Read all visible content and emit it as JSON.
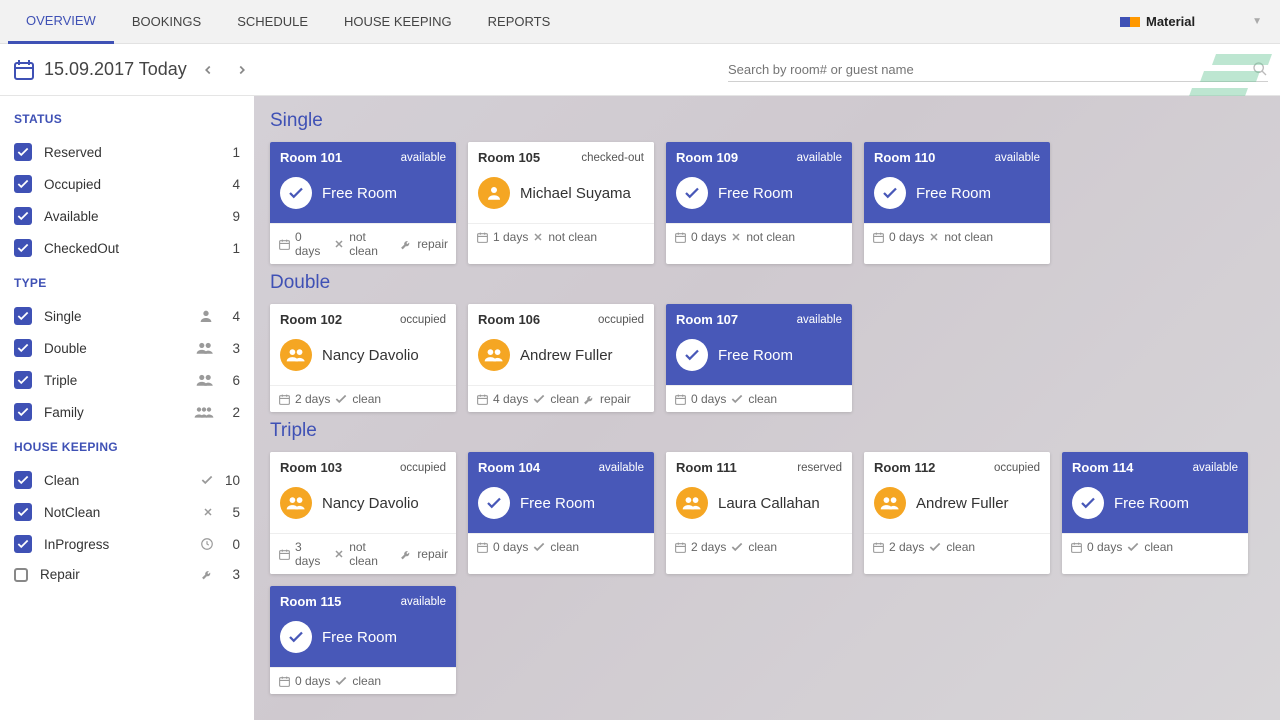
{
  "nav": {
    "tabs": [
      "OVERVIEW",
      "BOOKINGS",
      "SCHEDULE",
      "HOUSE KEEPING",
      "REPORTS"
    ],
    "active": 0
  },
  "theme": {
    "name": "Material",
    "swatch": [
      "#3f51b5",
      "#ff9800"
    ]
  },
  "date": {
    "text": "15.09.2017 Today"
  },
  "search": {
    "placeholder": "Search by room# or guest name"
  },
  "sidebar": {
    "groups": [
      {
        "title": "STATUS",
        "items": [
          {
            "label": "Reserved",
            "checked": true,
            "count": 1
          },
          {
            "label": "Occupied",
            "checked": true,
            "count": 4
          },
          {
            "label": "Available",
            "checked": true,
            "count": 9
          },
          {
            "label": "CheckedOut",
            "checked": true,
            "count": 1
          }
        ]
      },
      {
        "title": "TYPE",
        "items": [
          {
            "label": "Single",
            "checked": true,
            "icon": "person",
            "count": 4
          },
          {
            "label": "Double",
            "checked": true,
            "icon": "group",
            "count": 3
          },
          {
            "label": "Triple",
            "checked": true,
            "icon": "group",
            "count": 6
          },
          {
            "label": "Family",
            "checked": true,
            "icon": "group3",
            "count": 2
          }
        ]
      },
      {
        "title": "HOUSE KEEPING",
        "items": [
          {
            "label": "Clean",
            "checked": true,
            "icon": "check",
            "count": 10
          },
          {
            "label": "NotClean",
            "checked": true,
            "icon": "x",
            "count": 5
          },
          {
            "label": "InProgress",
            "checked": true,
            "icon": "clock",
            "count": 0
          },
          {
            "label": "Repair",
            "checked": false,
            "icon": "wrench",
            "count": 3
          }
        ]
      }
    ]
  },
  "sections": [
    {
      "title": "Single",
      "rooms": [
        {
          "name": "Room 101",
          "status": "available",
          "theme": "avail",
          "guest": "Free Room",
          "footer": [
            {
              "i": "cal",
              "t": "0 days"
            },
            {
              "i": "x",
              "t": "not clean"
            },
            {
              "i": "wrench",
              "t": "repair"
            }
          ]
        },
        {
          "name": "Room 105",
          "status": "checked-out",
          "theme": "white",
          "guest": "Michael Suyama",
          "guestIcon": "person",
          "footer": [
            {
              "i": "cal",
              "t": "1 days"
            },
            {
              "i": "x",
              "t": "not clean"
            }
          ]
        },
        {
          "name": "Room 109",
          "status": "available",
          "theme": "avail",
          "guest": "Free Room",
          "footer": [
            {
              "i": "cal",
              "t": "0 days"
            },
            {
              "i": "x",
              "t": "not clean"
            }
          ]
        },
        {
          "name": "Room 110",
          "status": "available",
          "theme": "avail",
          "guest": "Free Room",
          "footer": [
            {
              "i": "cal",
              "t": "0 days"
            },
            {
              "i": "x",
              "t": "not clean"
            }
          ]
        }
      ]
    },
    {
      "title": "Double",
      "rooms": [
        {
          "name": "Room 102",
          "status": "occupied",
          "theme": "white",
          "guest": "Nancy Davolio",
          "guestIcon": "group",
          "footer": [
            {
              "i": "cal",
              "t": "2 days"
            },
            {
              "i": "check",
              "t": "clean"
            }
          ]
        },
        {
          "name": "Room 106",
          "status": "occupied",
          "theme": "white",
          "guest": "Andrew Fuller",
          "guestIcon": "group",
          "footer": [
            {
              "i": "cal",
              "t": "4 days"
            },
            {
              "i": "check",
              "t": "clean"
            },
            {
              "i": "wrench",
              "t": "repair"
            }
          ]
        },
        {
          "name": "Room 107",
          "status": "available",
          "theme": "avail",
          "guest": "Free Room",
          "footer": [
            {
              "i": "cal",
              "t": "0 days"
            },
            {
              "i": "check",
              "t": "clean"
            }
          ]
        }
      ]
    },
    {
      "title": "Triple",
      "rooms": [
        {
          "name": "Room 103",
          "status": "occupied",
          "theme": "white",
          "guest": "Nancy Davolio",
          "guestIcon": "group",
          "footer": [
            {
              "i": "cal",
              "t": "3 days"
            },
            {
              "i": "x",
              "t": "not clean"
            },
            {
              "i": "wrench",
              "t": "repair"
            }
          ]
        },
        {
          "name": "Room 104",
          "status": "available",
          "theme": "avail",
          "guest": "Free Room",
          "footer": [
            {
              "i": "cal",
              "t": "0 days"
            },
            {
              "i": "check",
              "t": "clean"
            }
          ]
        },
        {
          "name": "Room 111",
          "status": "reserved",
          "theme": "white",
          "guest": "Laura Callahan",
          "guestIcon": "group",
          "footer": [
            {
              "i": "cal",
              "t": "2 days"
            },
            {
              "i": "check",
              "t": "clean"
            }
          ]
        },
        {
          "name": "Room 112",
          "status": "occupied",
          "theme": "white",
          "guest": "Andrew Fuller",
          "guestIcon": "group",
          "footer": [
            {
              "i": "cal",
              "t": "2 days"
            },
            {
              "i": "check",
              "t": "clean"
            }
          ]
        },
        {
          "name": "Room 114",
          "status": "available",
          "theme": "avail",
          "guest": "Free Room",
          "footer": [
            {
              "i": "cal",
              "t": "0 days"
            },
            {
              "i": "check",
              "t": "clean"
            }
          ]
        },
        {
          "name": "Room 115",
          "status": "available",
          "theme": "avail",
          "guest": "Free Room",
          "footer": [
            {
              "i": "cal",
              "t": "0 days"
            },
            {
              "i": "check",
              "t": "clean"
            }
          ]
        }
      ]
    }
  ]
}
